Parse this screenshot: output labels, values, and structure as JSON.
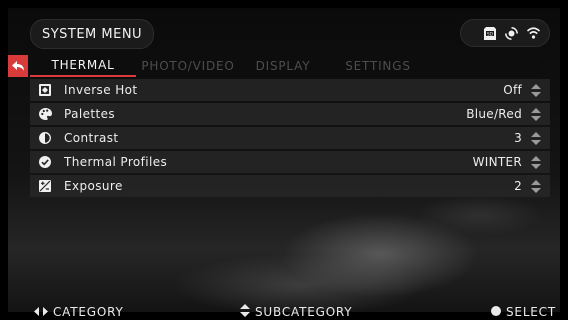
{
  "header": {
    "menu_title": "SYSTEM MENU",
    "status_icons": [
      "sd-card-icon",
      "gps-icon",
      "wifi-icon"
    ]
  },
  "tabs": [
    {
      "label": "THERMAL",
      "active": true
    },
    {
      "label": "PHOTO/VIDEO",
      "active": false
    },
    {
      "label": "DISPLAY",
      "active": false
    },
    {
      "label": "SETTINGS",
      "active": false
    }
  ],
  "rows": [
    {
      "label": "Inverse Hot",
      "value": "Off",
      "icon": "inverse-hot-icon"
    },
    {
      "label": "Palettes",
      "value": "Blue/Red",
      "icon": "palette-icon"
    },
    {
      "label": "Contrast",
      "value": "3",
      "icon": "contrast-icon"
    },
    {
      "label": "Thermal Profiles",
      "value": "WINTER",
      "icon": "check-circle-icon"
    },
    {
      "label": "Exposure",
      "value": "2",
      "icon": "exposure-icon"
    }
  ],
  "footer": {
    "category": "CATEGORY",
    "subcategory": "SUBCATEGORY",
    "select": "SELECT"
  },
  "colors": {
    "accent": "#d93a3a",
    "row_bg": "#262626",
    "inactive_tab": "#4d4d4d"
  }
}
